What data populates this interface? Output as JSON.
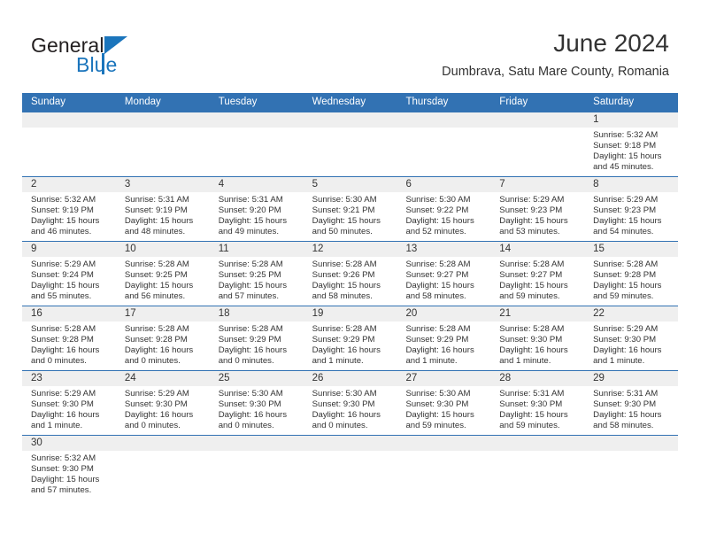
{
  "brand": {
    "name_top": "General",
    "name_bottom": "Blue",
    "color_black": "#231f20",
    "color_blue": "#1b75bc"
  },
  "header": {
    "title": "June 2024",
    "subtitle": "Dumbrava, Satu Mare County, Romania"
  },
  "theme": {
    "header_blue": "#3272b3",
    "daynum_band": "#efefef",
    "text": "#333333"
  },
  "weekdays": [
    "Sunday",
    "Monday",
    "Tuesday",
    "Wednesday",
    "Thursday",
    "Friday",
    "Saturday"
  ],
  "weeks": [
    [
      {
        "day": "",
        "empty": true
      },
      {
        "day": "",
        "empty": true
      },
      {
        "day": "",
        "empty": true
      },
      {
        "day": "",
        "empty": true
      },
      {
        "day": "",
        "empty": true
      },
      {
        "day": "",
        "empty": true
      },
      {
        "day": "1",
        "sunrise": "Sunrise: 5:32 AM",
        "sunset": "Sunset: 9:18 PM",
        "daylight1": "Daylight: 15 hours",
        "daylight2": "and 45 minutes."
      }
    ],
    [
      {
        "day": "2",
        "sunrise": "Sunrise: 5:32 AM",
        "sunset": "Sunset: 9:19 PM",
        "daylight1": "Daylight: 15 hours",
        "daylight2": "and 46 minutes."
      },
      {
        "day": "3",
        "sunrise": "Sunrise: 5:31 AM",
        "sunset": "Sunset: 9:19 PM",
        "daylight1": "Daylight: 15 hours",
        "daylight2": "and 48 minutes."
      },
      {
        "day": "4",
        "sunrise": "Sunrise: 5:31 AM",
        "sunset": "Sunset: 9:20 PM",
        "daylight1": "Daylight: 15 hours",
        "daylight2": "and 49 minutes."
      },
      {
        "day": "5",
        "sunrise": "Sunrise: 5:30 AM",
        "sunset": "Sunset: 9:21 PM",
        "daylight1": "Daylight: 15 hours",
        "daylight2": "and 50 minutes."
      },
      {
        "day": "6",
        "sunrise": "Sunrise: 5:30 AM",
        "sunset": "Sunset: 9:22 PM",
        "daylight1": "Daylight: 15 hours",
        "daylight2": "and 52 minutes."
      },
      {
        "day": "7",
        "sunrise": "Sunrise: 5:29 AM",
        "sunset": "Sunset: 9:23 PM",
        "daylight1": "Daylight: 15 hours",
        "daylight2": "and 53 minutes."
      },
      {
        "day": "8",
        "sunrise": "Sunrise: 5:29 AM",
        "sunset": "Sunset: 9:23 PM",
        "daylight1": "Daylight: 15 hours",
        "daylight2": "and 54 minutes."
      }
    ],
    [
      {
        "day": "9",
        "sunrise": "Sunrise: 5:29 AM",
        "sunset": "Sunset: 9:24 PM",
        "daylight1": "Daylight: 15 hours",
        "daylight2": "and 55 minutes."
      },
      {
        "day": "10",
        "sunrise": "Sunrise: 5:28 AM",
        "sunset": "Sunset: 9:25 PM",
        "daylight1": "Daylight: 15 hours",
        "daylight2": "and 56 minutes."
      },
      {
        "day": "11",
        "sunrise": "Sunrise: 5:28 AM",
        "sunset": "Sunset: 9:25 PM",
        "daylight1": "Daylight: 15 hours",
        "daylight2": "and 57 minutes."
      },
      {
        "day": "12",
        "sunrise": "Sunrise: 5:28 AM",
        "sunset": "Sunset: 9:26 PM",
        "daylight1": "Daylight: 15 hours",
        "daylight2": "and 58 minutes."
      },
      {
        "day": "13",
        "sunrise": "Sunrise: 5:28 AM",
        "sunset": "Sunset: 9:27 PM",
        "daylight1": "Daylight: 15 hours",
        "daylight2": "and 58 minutes."
      },
      {
        "day": "14",
        "sunrise": "Sunrise: 5:28 AM",
        "sunset": "Sunset: 9:27 PM",
        "daylight1": "Daylight: 15 hours",
        "daylight2": "and 59 minutes."
      },
      {
        "day": "15",
        "sunrise": "Sunrise: 5:28 AM",
        "sunset": "Sunset: 9:28 PM",
        "daylight1": "Daylight: 15 hours",
        "daylight2": "and 59 minutes."
      }
    ],
    [
      {
        "day": "16",
        "sunrise": "Sunrise: 5:28 AM",
        "sunset": "Sunset: 9:28 PM",
        "daylight1": "Daylight: 16 hours",
        "daylight2": "and 0 minutes."
      },
      {
        "day": "17",
        "sunrise": "Sunrise: 5:28 AM",
        "sunset": "Sunset: 9:28 PM",
        "daylight1": "Daylight: 16 hours",
        "daylight2": "and 0 minutes."
      },
      {
        "day": "18",
        "sunrise": "Sunrise: 5:28 AM",
        "sunset": "Sunset: 9:29 PM",
        "daylight1": "Daylight: 16 hours",
        "daylight2": "and 0 minutes."
      },
      {
        "day": "19",
        "sunrise": "Sunrise: 5:28 AM",
        "sunset": "Sunset: 9:29 PM",
        "daylight1": "Daylight: 16 hours",
        "daylight2": "and 1 minute."
      },
      {
        "day": "20",
        "sunrise": "Sunrise: 5:28 AM",
        "sunset": "Sunset: 9:29 PM",
        "daylight1": "Daylight: 16 hours",
        "daylight2": "and 1 minute."
      },
      {
        "day": "21",
        "sunrise": "Sunrise: 5:28 AM",
        "sunset": "Sunset: 9:30 PM",
        "daylight1": "Daylight: 16 hours",
        "daylight2": "and 1 minute."
      },
      {
        "day": "22",
        "sunrise": "Sunrise: 5:29 AM",
        "sunset": "Sunset: 9:30 PM",
        "daylight1": "Daylight: 16 hours",
        "daylight2": "and 1 minute."
      }
    ],
    [
      {
        "day": "23",
        "sunrise": "Sunrise: 5:29 AM",
        "sunset": "Sunset: 9:30 PM",
        "daylight1": "Daylight: 16 hours",
        "daylight2": "and 1 minute."
      },
      {
        "day": "24",
        "sunrise": "Sunrise: 5:29 AM",
        "sunset": "Sunset: 9:30 PM",
        "daylight1": "Daylight: 16 hours",
        "daylight2": "and 0 minutes."
      },
      {
        "day": "25",
        "sunrise": "Sunrise: 5:30 AM",
        "sunset": "Sunset: 9:30 PM",
        "daylight1": "Daylight: 16 hours",
        "daylight2": "and 0 minutes."
      },
      {
        "day": "26",
        "sunrise": "Sunrise: 5:30 AM",
        "sunset": "Sunset: 9:30 PM",
        "daylight1": "Daylight: 16 hours",
        "daylight2": "and 0 minutes."
      },
      {
        "day": "27",
        "sunrise": "Sunrise: 5:30 AM",
        "sunset": "Sunset: 9:30 PM",
        "daylight1": "Daylight: 15 hours",
        "daylight2": "and 59 minutes."
      },
      {
        "day": "28",
        "sunrise": "Sunrise: 5:31 AM",
        "sunset": "Sunset: 9:30 PM",
        "daylight1": "Daylight: 15 hours",
        "daylight2": "and 59 minutes."
      },
      {
        "day": "29",
        "sunrise": "Sunrise: 5:31 AM",
        "sunset": "Sunset: 9:30 PM",
        "daylight1": "Daylight: 15 hours",
        "daylight2": "and 58 minutes."
      }
    ],
    [
      {
        "day": "30",
        "sunrise": "Sunrise: 5:32 AM",
        "sunset": "Sunset: 9:30 PM",
        "daylight1": "Daylight: 15 hours",
        "daylight2": "and 57 minutes."
      },
      {
        "day": "",
        "empty": true
      },
      {
        "day": "",
        "empty": true
      },
      {
        "day": "",
        "empty": true
      },
      {
        "day": "",
        "empty": true
      },
      {
        "day": "",
        "empty": true
      },
      {
        "day": "",
        "empty": true
      }
    ]
  ]
}
